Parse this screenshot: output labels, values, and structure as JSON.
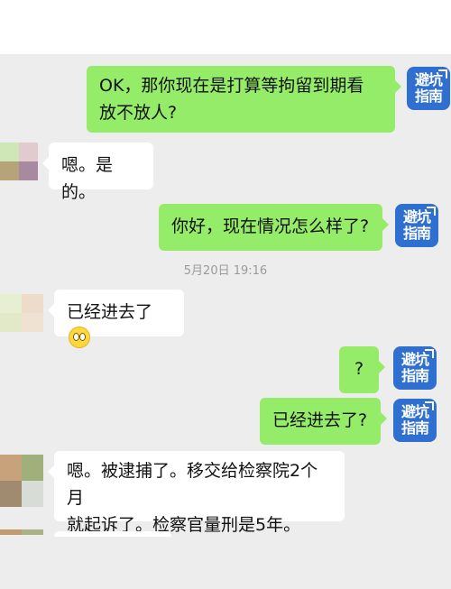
{
  "messages": [
    {
      "id": "m1",
      "sender": "me",
      "text_line1": "OK，那你现在是打算等拘留到期看",
      "text_line2": "放不放人?"
    },
    {
      "id": "m2",
      "sender": "other",
      "text": "嗯。是的。"
    },
    {
      "id": "m3",
      "sender": "me",
      "text": "你好，现在情况怎么样了?"
    },
    {
      "id": "m4",
      "sender": "other",
      "text": "已经进去了",
      "emoji": "grimace-emoji"
    },
    {
      "id": "m5",
      "sender": "me",
      "text": "?"
    },
    {
      "id": "m6",
      "sender": "me",
      "text": "已经进去了?"
    },
    {
      "id": "m7",
      "sender": "other",
      "text_line1": "嗯。被逮捕了。移交给检察院2个月",
      "text_line2": "就起诉了。检察官量刑是5年。"
    }
  ],
  "timestamp": "5月20日 19:16",
  "logo": {
    "line1": "避坑",
    "line2": "指南",
    "color": "#2f6fd0"
  },
  "colors": {
    "my_bubble": "#95ec69",
    "other_bubble": "#ffffff",
    "chat_bg": "#ededed"
  }
}
